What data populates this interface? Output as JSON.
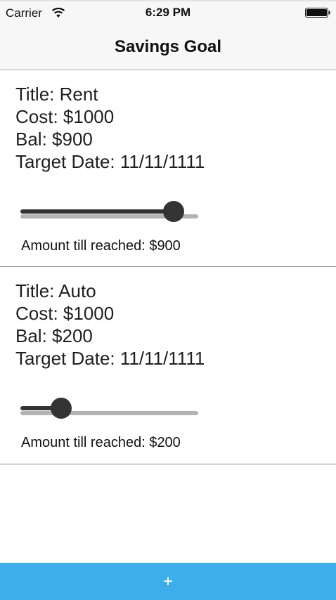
{
  "status_bar": {
    "carrier": "Carrier",
    "time": "6:29 PM",
    "wifi_icon": "wifi-icon",
    "battery_icon": "battery-icon"
  },
  "nav": {
    "title": "Savings Goal"
  },
  "goals": [
    {
      "title": "Title: Rent",
      "cost": "Cost: $1000",
      "bal": "Bal: $900",
      "target_date": "Target Date: 11/11/1111",
      "amount_till_reached": "Amount till reached: $900",
      "progress": 0.9
    },
    {
      "title": "Title: Auto",
      "cost": "Cost: $1000",
      "bal": "Bal: $200",
      "target_date": "Target Date: 11/11/1111",
      "amount_till_reached": "Amount till reached: $200",
      "progress": 0.2
    }
  ],
  "add_button": {
    "label": "+",
    "color": "#3daee9"
  }
}
